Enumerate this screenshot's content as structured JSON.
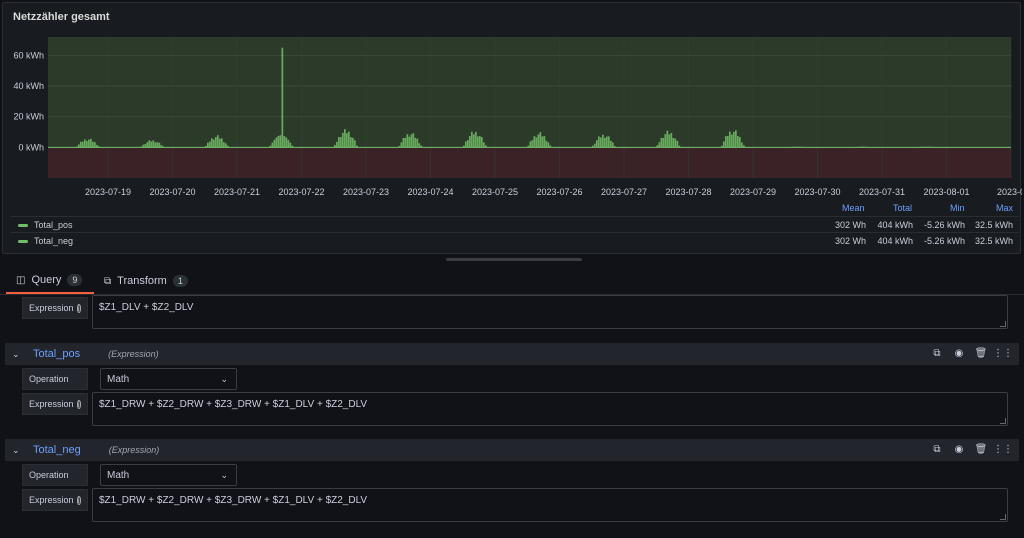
{
  "panel": {
    "title": "Netzzähler gesamt"
  },
  "chart_data": {
    "type": "area",
    "title": "Netzzähler gesamt",
    "y_ticks": [
      "60 kWh",
      "40 kWh",
      "20 kWh",
      "0 kWh"
    ],
    "y_tick_values": [
      60,
      40,
      20,
      0
    ],
    "ylim": [
      -20,
      72
    ],
    "x_ticks": [
      "2023-07-19",
      "2023-07-20",
      "2023-07-21",
      "2023-07-22",
      "2023-07-23",
      "2023-07-24",
      "2023-07-25",
      "2023-07-26",
      "2023-07-27",
      "2023-07-28",
      "2023-07-29",
      "2023-07-30",
      "2023-07-31",
      "2023-08-01",
      "2023-0"
    ],
    "grid": true,
    "legend_placement": "bottom",
    "colors": {
      "positive": "#73bf69",
      "negative": "#f2495c",
      "positive_fill": "#2c3a2a",
      "negative_fill": "#3a2226"
    },
    "series": [
      {
        "name": "Total_pos",
        "x": [
          "2023-07-19",
          "2023-07-20",
          "2023-07-21",
          "2023-07-22",
          "2023-07-23",
          "2023-07-24",
          "2023-07-25",
          "2023-07-26",
          "2023-07-27",
          "2023-07-28",
          "2023-07-29",
          "2023-07-30",
          "2023-07-31",
          "2023-08-01"
        ],
        "daily_peak": [
          6,
          5,
          8,
          65,
          12,
          10,
          11,
          10,
          9,
          11,
          12,
          0.5,
          0.5,
          0.5
        ]
      },
      {
        "name": "Total_neg",
        "x": [
          "2023-07-19",
          "2023-07-20",
          "2023-07-21",
          "2023-07-22",
          "2023-07-23",
          "2023-07-24",
          "2023-07-25",
          "2023-07-26",
          "2023-07-27",
          "2023-07-28",
          "2023-07-29",
          "2023-07-30",
          "2023-07-31",
          "2023-08-01"
        ],
        "daily_min": [
          -4,
          -3,
          -5,
          -2,
          -1,
          -2,
          -5,
          -4,
          -1,
          -1,
          -1,
          0,
          0,
          0
        ]
      }
    ]
  },
  "legend": {
    "headers": [
      "Mean",
      "Total",
      "Min",
      "Max"
    ],
    "rows": [
      {
        "name": "Total_pos",
        "values": [
          "302 Wh",
          "404 kWh",
          "-5.26 kWh",
          "32.5 kWh"
        ]
      },
      {
        "name": "Total_neg",
        "values": [
          "302 Wh",
          "404 kWh",
          "-5.26 kWh",
          "32.5 kWh"
        ]
      }
    ]
  },
  "tabs": [
    {
      "label": "Query",
      "count": "9",
      "icon": "database-icon"
    },
    {
      "label": "Transform",
      "count": "1",
      "icon": "transform-icon"
    }
  ],
  "editor": {
    "expression_label": "Expression",
    "operation_label": "Operation",
    "top_expression": "$Z1_DLV + $Z2_DLV",
    "queries": [
      {
        "name": "Total_pos",
        "type": "(Expression)",
        "operation": "Math",
        "expression": "$Z1_DRW + $Z2_DRW + $Z3_DRW + $Z1_DLV + $Z2_DLV"
      },
      {
        "name": "Total_neg",
        "type": "(Expression)",
        "operation": "Math",
        "expression": "$Z1_DRW + $Z2_DRW + $Z3_DRW + $Z1_DLV + $Z2_DLV"
      }
    ]
  }
}
